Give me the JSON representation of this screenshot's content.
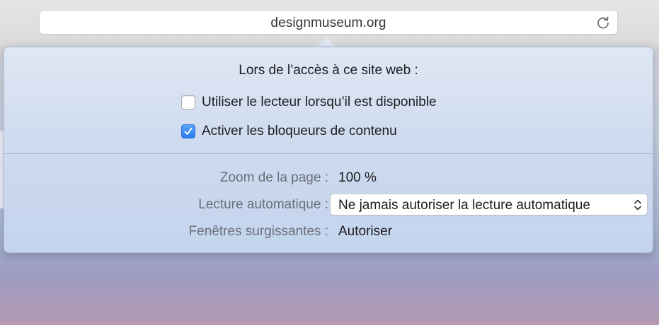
{
  "browser": {
    "url": "designmuseum.org",
    "reload_icon": "reload-icon"
  },
  "popover": {
    "title": "Lors de l’accès à ce site web :",
    "options": [
      {
        "label": "Utiliser le lecteur lorsqu’il est disponible",
        "checked": false
      },
      {
        "label": "Activer les bloqueurs de contenu",
        "checked": true
      }
    ],
    "settings": {
      "zoom": {
        "label": "Zoom de la page :",
        "value": "100 %"
      },
      "autoplay": {
        "label": "Lecture automatique :",
        "value": "Ne jamais autoriser la lecture automatique"
      },
      "popups": {
        "label": "Fenêtres surgissantes :",
        "value": "Autoriser"
      }
    }
  },
  "colors": {
    "accent": "#2a7cf0",
    "popover_bg": "#cfdbef",
    "label_gray": "#6b6f78"
  }
}
